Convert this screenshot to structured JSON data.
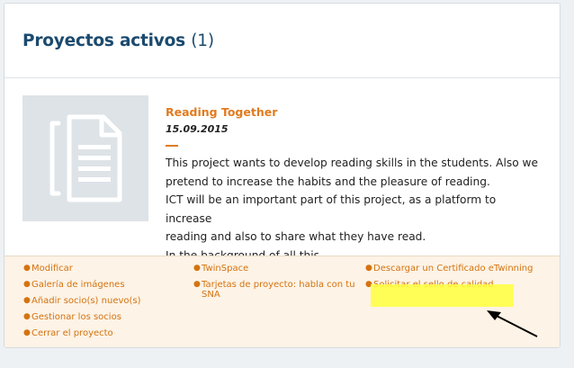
{
  "header": {
    "title": "Proyectos activos",
    "count": "(1)"
  },
  "project": {
    "title": "Reading Together",
    "date": "15.09.2015",
    "description": "This project wants to develop reading skills in the students. Also we\npretend to increase the habits and the pleasure of reading.\nICT will be an important part of this project, as a platform to increase\nreading and also to share what they have read.\nIn the background of all this..."
  },
  "actions": {
    "col1": [
      "Modificar",
      "Galería de imágenes",
      "Añadir socio(s) nuevo(s)",
      "Gestionar los socios",
      "Cerrar el proyecto"
    ],
    "col2": [
      "TwinSpace",
      "Tarjetas de proyecto: habla con tu SNA"
    ],
    "col3": [
      "Descargar un Certificado eTwinning",
      "Solicitar el sello de calidad"
    ]
  },
  "colors": {
    "title": "#1b4a6e",
    "accent": "#e07b20",
    "highlight": "#ffff3c"
  },
  "icons": {
    "thumbnail": "document-icon",
    "bullet": "bullet-dot"
  }
}
